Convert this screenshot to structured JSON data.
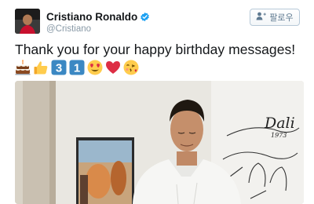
{
  "author": {
    "display_name": "Cristiano Ronaldo",
    "handle": "@Cristiano",
    "verified": true,
    "avatar_icon": "profile-photo"
  },
  "follow_button": {
    "label": "팔로우",
    "icon": "add-user-icon"
  },
  "tweet": {
    "text": "Thank you for your happy birthday messages!",
    "emojis": [
      "birthday-cake",
      "thumbs-up",
      "keycap-3",
      "keycap-1",
      "heart-eyes-face",
      "red-heart",
      "face-blowing-kiss"
    ],
    "keycap_digits": [
      "3",
      "1"
    ]
  },
  "photo": {
    "signature_text": "Dali",
    "signature_year": "1973"
  },
  "colors": {
    "name": "#14171a",
    "secondary": "#8899a6",
    "verified": "#1da1f2",
    "button_text": "#5f7a91",
    "keycap": "#3b88c3",
    "heart": "#dd2e44"
  }
}
